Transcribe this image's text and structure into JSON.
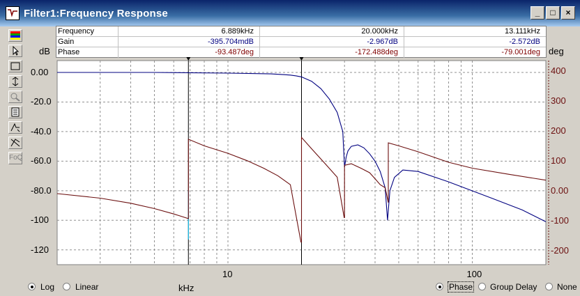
{
  "window": {
    "title": "Filter1:Frequency Response"
  },
  "title_buttons": {
    "minimize": "_",
    "maximize": "□",
    "close": "×"
  },
  "toolbar": {
    "items": [
      {
        "name": "color-bars-icon"
      },
      {
        "name": "pointer-arrow-icon"
      },
      {
        "name": "box-zoom-icon"
      },
      {
        "name": "fit-arrows-icon"
      },
      {
        "name": "magnifier-icon"
      },
      {
        "name": "document-icon"
      },
      {
        "name": "cursor-step-icon"
      },
      {
        "name": "cursor-jump-icon"
      },
      {
        "name": "foq-label",
        "label": "FoQ"
      }
    ]
  },
  "readout": {
    "rows": [
      {
        "label": "Frequency",
        "values": [
          "6.889kHz",
          "20.000kHz",
          "13.111kHz"
        ],
        "color": "#000000"
      },
      {
        "label": "Gain",
        "values": [
          "-395.704mdB",
          "-2.967dB",
          "-2.572dB"
        ],
        "color": "#000080"
      },
      {
        "label": "Phase",
        "values": [
          "-93.487deg",
          "-172.488deg",
          "-79.001deg"
        ],
        "color": "#800000"
      }
    ]
  },
  "axes": {
    "left_unit": "dB",
    "right_unit": "deg",
    "x_unit": "kHz",
    "x_ticks": [
      "10",
      "100"
    ],
    "left_ticks": [
      "0.00",
      "-20.0",
      "-40.0",
      "-60.0",
      "-80.0",
      "-100",
      "-120"
    ],
    "right_ticks": [
      "400",
      "300",
      "200",
      "100",
      "0.00",
      "-100",
      "-200"
    ]
  },
  "chart_data": {
    "type": "line",
    "xscale": "log",
    "xlim": [
      2.0,
      200.0
    ],
    "ylim_left": [
      -130,
      8
    ],
    "ylim_right": [
      -247.5,
      435
    ],
    "cursors_khz": [
      6.889,
      20.0
    ],
    "series": [
      {
        "axis": "left",
        "color": "#000080",
        "x": [
          2.0,
          5.0,
          10.0,
          15.0,
          17.0,
          18.0,
          19.0,
          20.0,
          22.0,
          24.0,
          26.0,
          28.0,
          29.5,
          30.0,
          30.5,
          31.0,
          32.0,
          34.0,
          36.0,
          38.0,
          40.0,
          42.0,
          44.0,
          45.0,
          46.0,
          48.0,
          52.0,
          60.0,
          80.0,
          120.0,
          160.0,
          200.0
        ],
        "y": [
          0,
          0,
          -0.5,
          -1.0,
          -1.5,
          -1.8,
          -2.3,
          -3.0,
          -6.0,
          -11.0,
          -18.0,
          -27.0,
          -40.0,
          -64.0,
          -57.0,
          -53.0,
          -50.0,
          -49.0,
          -51.0,
          -55.0,
          -60.0,
          -67.0,
          -78.0,
          -100.0,
          -80.0,
          -71.0,
          -66.0,
          -67.0,
          -74.0,
          -85.0,
          -93.0,
          -101.0
        ]
      },
      {
        "axis": "right",
        "color": "#6b0f0f",
        "x": [
          2.0,
          3.0,
          4.0,
          5.0,
          6.0,
          6.889,
          6.889,
          8.0,
          10.0,
          12.0,
          14.0,
          16.0,
          18.0,
          19.9,
          20.0,
          20.0,
          22.0,
          25.0,
          28.0,
          29.9,
          30.0,
          30.0,
          32.0,
          35.0,
          38.0,
          40.0,
          42.0,
          44.0,
          45.3,
          45.3,
          50.0,
          60.0,
          80.0,
          100.0,
          140.0,
          200.0
        ],
        "y": [
          -10,
          -25,
          -42,
          -60,
          -78,
          -93.5,
          172,
          150,
          125,
          100,
          75,
          50,
          20,
          -172,
          -172,
          178,
          140,
          90,
          45,
          -90,
          -90,
          85,
          90,
          75,
          60,
          40,
          20,
          10,
          -40,
          160,
          150,
          130,
          95,
          75,
          55,
          35
        ]
      }
    ]
  },
  "bottom_bar": {
    "x_scale_options": [
      {
        "label": "Log",
        "selected": true
      },
      {
        "label": "Linear",
        "selected": false
      }
    ],
    "x_label": "kHz",
    "display_options": [
      {
        "label": "Phase",
        "selected": true
      },
      {
        "label": "Group Delay",
        "selected": false
      },
      {
        "label": "None",
        "selected": false
      }
    ]
  }
}
